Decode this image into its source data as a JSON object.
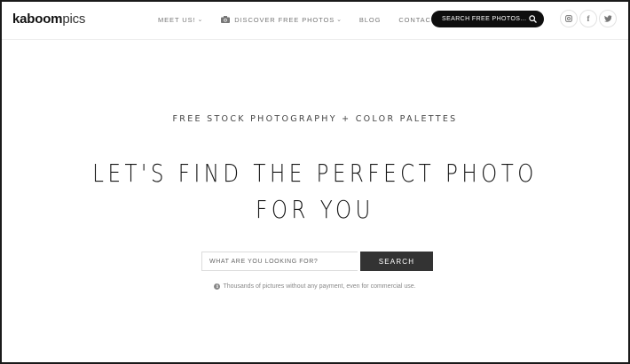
{
  "header": {
    "logo_bold": "kaboom",
    "logo_light": "pics",
    "nav": [
      {
        "label": "MEET US!",
        "has_dropdown": true
      },
      {
        "label": "DISCOVER FREE PHOTOS",
        "has_dropdown": true,
        "icon": "camera-icon"
      },
      {
        "label": "BLOG",
        "has_dropdown": false
      },
      {
        "label": "CONTACT",
        "has_dropdown": false
      }
    ],
    "search_pill_label": "SEARCH FREE PHOTOS...",
    "socials": [
      "instagram-icon",
      "facebook-icon",
      "twitter-icon"
    ]
  },
  "hero": {
    "tagline": "FREE STOCK PHOTOGRAPHY + COLOR PALETTES",
    "headline_line1": "LET'S FIND THE PERFECT PHOTO",
    "headline_line2": "FOR YOU",
    "search_placeholder": "WHAT ARE YOU LOOKING FOR?",
    "search_button": "SEARCH",
    "note": "Thousands of pictures without any payment, even for commercial use."
  },
  "colors": {
    "dark": "#0e0e0e",
    "button": "#333333",
    "muted_text": "#777777"
  }
}
